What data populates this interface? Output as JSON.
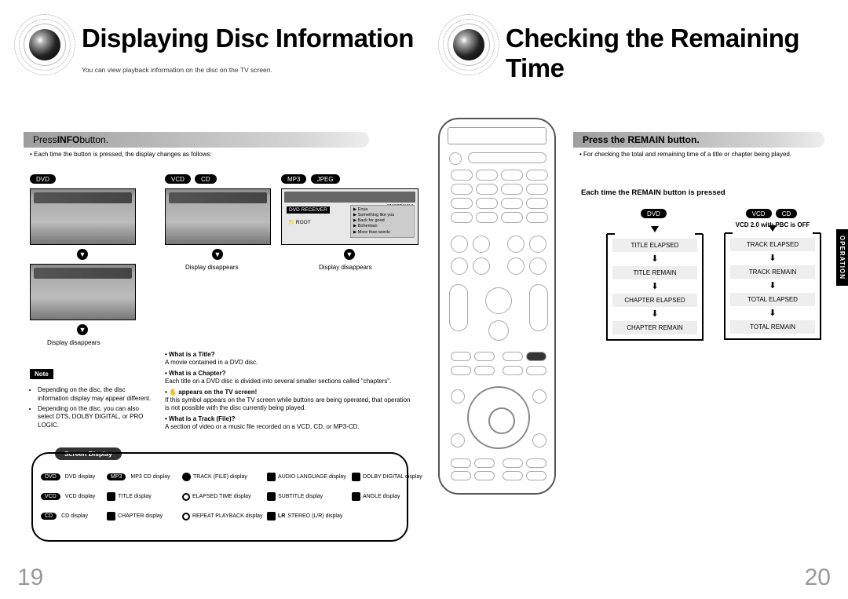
{
  "left": {
    "title": "Displaying Disc Information",
    "subtitle": "You can view playback information on the disc on the TV screen.",
    "step_label_pre": "Press ",
    "step_label_bold": "INFO",
    "step_label_post": " button.",
    "step_sub": "Each time the button is pressed, the display changes as follows:",
    "pills": {
      "dvd": "DVD",
      "vcd": "VCD",
      "cd": "CD",
      "mp3": "MP3",
      "jpeg": "JPEG"
    },
    "mp3_panel": {
      "receiver": "DVD RECEIVER",
      "smartnavi": "SMART NAVI",
      "root": "ROOT",
      "tracks": [
        "Enya",
        "Something like you",
        "Back for good",
        "Bohemian",
        "More than words"
      ]
    },
    "display_disappears": "Display disappears",
    "note_label": "Note",
    "notes": [
      "Depending on the disc, the disc information display may appear different.",
      "Depending on the disc, you can also select DTS, DOLBY DIGITAL, or PRO LOGIC."
    ],
    "defs": [
      {
        "t": "What is a Title?",
        "b": "A movie contained in a DVD disc."
      },
      {
        "t": "What is a Chapter?",
        "b": "Each title on a DVD disc is divided into several smaller sections called \"chapters\"."
      },
      {
        "t": "appears on the TV screen!",
        "b": "If this symbol appears on the TV screen while buttons are being operated, that operation is not possible with the disc currently being played.",
        "hand": true
      },
      {
        "t": "What is a Track (File)?",
        "b": "A section of video or a music file recorded on a VCD, CD, or MP3-CD."
      }
    ],
    "screen_display_label": "Screen Display",
    "sd": {
      "r1": [
        "DVD display",
        "MP3 CD display",
        "TRACK (FILE) display",
        "AUDIO LANGUAGE display",
        "DOLBY DIGITAL display"
      ],
      "r2": [
        "VCD display",
        "TITLE display",
        "ELAPSED TIME display",
        "SUBTITLE display",
        "ANGLE display"
      ],
      "r3": [
        "CD display",
        "CHAPTER display",
        "REPEAT PLAYBACK display",
        "STEREO (L/R) display",
        ""
      ]
    },
    "sd_pills": {
      "dvd": "DVD",
      "mp3": "MP3",
      "vcd": "VCD",
      "cd": "CD",
      "lr": "LR"
    },
    "page_num": "19"
  },
  "right": {
    "title": "Checking the Remaining Time",
    "step_label": "Press the REMAIN button.",
    "step_sub": "For checking the total and remaining time of a title or chapter being played.",
    "each_time": "Each time the REMAIN button is pressed",
    "pills": {
      "dvd": "DVD",
      "vcd": "VCD",
      "cd": "CD"
    },
    "vcd_note": "VCD 2.0 with PBC is OFF",
    "dvd_seq": [
      "TITLE ELAPSED",
      "TITLE REMAIN",
      "CHAPTER ELAPSED",
      "CHAPTER REMAIN"
    ],
    "vcd_seq": [
      "TRACK ELAPSED",
      "TRACK REMAIN",
      "TOTAL ELAPSED",
      "TOTAL REMAIN"
    ],
    "side_tab": "OPERATION",
    "page_num": "20"
  }
}
